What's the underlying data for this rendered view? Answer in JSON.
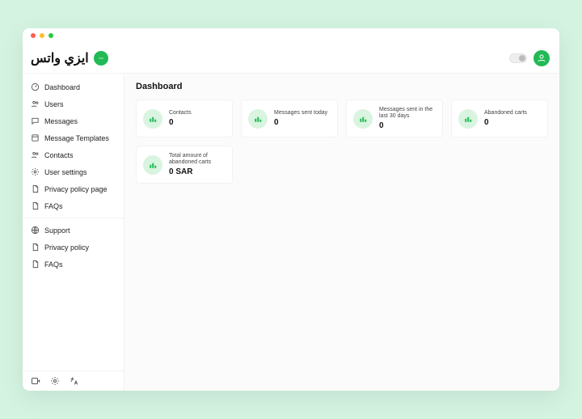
{
  "brand": {
    "text": "ايزي واتس"
  },
  "sidebar": {
    "items": [
      {
        "label": "Dashboard",
        "icon": "gauge"
      },
      {
        "label": "Users",
        "icon": "users"
      },
      {
        "label": "Messages",
        "icon": "message"
      },
      {
        "label": "Message Templates",
        "icon": "template"
      },
      {
        "label": "Contacts",
        "icon": "users"
      },
      {
        "label": "User settings",
        "icon": "gear"
      },
      {
        "label": "Privacy policy page",
        "icon": "file"
      },
      {
        "label": "FAQs",
        "icon": "file"
      }
    ],
    "support_items": [
      {
        "label": "Support",
        "icon": "globe"
      },
      {
        "label": "Privacy policy",
        "icon": "file"
      },
      {
        "label": "FAQs",
        "icon": "file"
      }
    ]
  },
  "page": {
    "title": "Dashboard"
  },
  "cards": [
    {
      "label": "Contacts",
      "value": "0"
    },
    {
      "label": "Messages sent today",
      "value": "0"
    },
    {
      "label": "Messages sent in the last 30 days",
      "value": "0"
    },
    {
      "label": "Abandoned carts",
      "value": "0"
    },
    {
      "label": "Total amount of abandoned carts",
      "value": "0 SAR"
    }
  ]
}
